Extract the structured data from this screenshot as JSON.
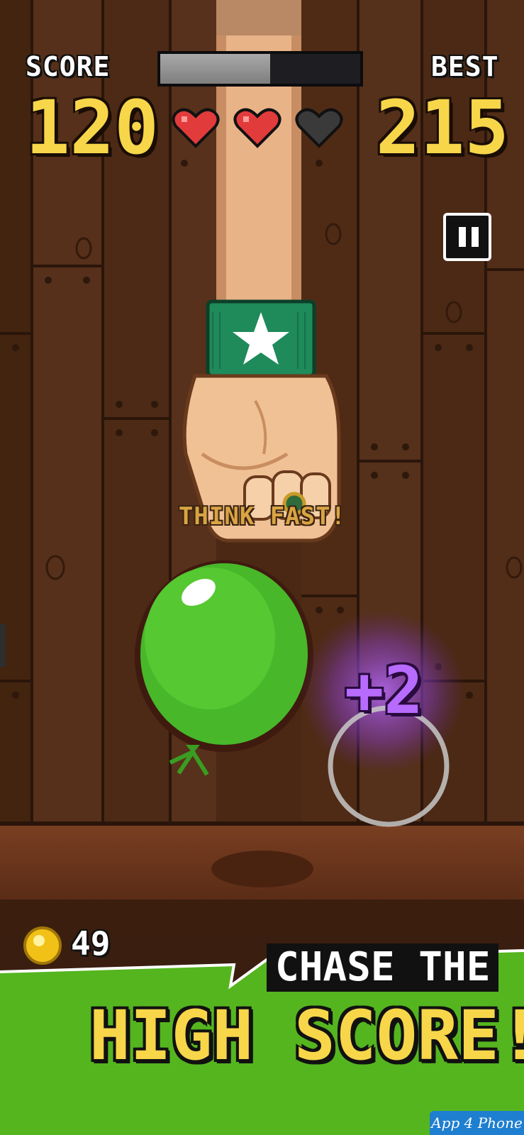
{
  "hud": {
    "score_label": "SCORE",
    "score_value": "120",
    "best_label": "BEST",
    "best_value": "215",
    "progress_fraction": 0.55,
    "lives_total": 3,
    "lives_remaining": 2,
    "pause_icon": "pause-icon"
  },
  "game": {
    "popup_text": "THINK FAST!",
    "bonus_text": "+2",
    "target": "green-balloon",
    "tap_ring": "tap-ring"
  },
  "coins": {
    "icon": "coin-icon",
    "count": "49"
  },
  "promo": {
    "line1": "CHASE THE",
    "line2": "HIGH SCORE!"
  },
  "watermark": "App 4 Phone",
  "colors": {
    "score_yellow": "#f7d64a",
    "heart_red": "#e23b3b",
    "heart_empty": "#3a3a3a",
    "balloon_green": "#4cc72a",
    "bonus_purple": "#b86bff",
    "banner_green": "#55b51f"
  }
}
